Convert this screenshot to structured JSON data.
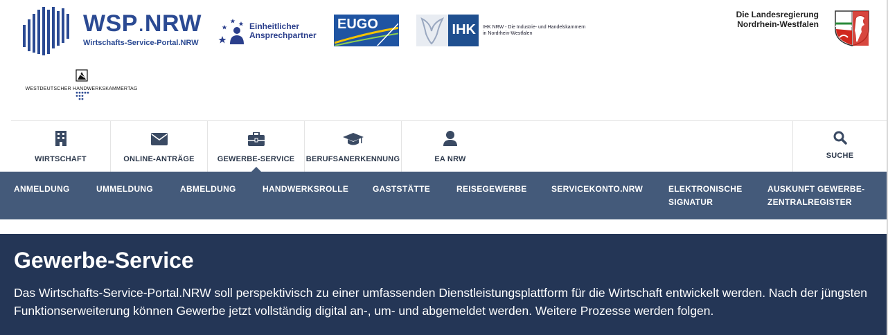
{
  "header": {
    "wsp_title": "WSP",
    "wsp_title_suffix": "NRW",
    "wsp_subtitle": "Wirtschafts-Service-Portal.NRW",
    "eap_line1": "Einheitlicher",
    "eap_line2": "Ansprechpartner",
    "eugo": "EUGO",
    "ihk_word": "IHK",
    "ihk_small_line1": "IHK NRW - Die Industrie- und Handelskammern",
    "ihk_small_line2": "in Nordrhein-Westfalen",
    "landesregierung_line1": "Die Landesregierung",
    "landesregierung_line2": "Nordrhein-Westfalen",
    "hwk_label": "WESTDEUTSCHER HANDWERKSKAMMERTAG"
  },
  "mainnav": {
    "items": [
      {
        "label": "WIRTSCHAFT",
        "icon": "building-icon"
      },
      {
        "label": "ONLINE-ANTRÄGE",
        "icon": "envelope-icon"
      },
      {
        "label": "GEWERBE-SERVICE",
        "icon": "briefcase-icon",
        "active": true
      },
      {
        "label": "BERUFSANERKENNUNG",
        "icon": "graduation-cap-icon"
      },
      {
        "label": "EA NRW",
        "icon": "user-icon"
      }
    ],
    "search_label": "SUCHE"
  },
  "subnav": {
    "items": [
      {
        "line1": "ANMELDUNG",
        "line2": ""
      },
      {
        "line1": "UMMELDUNG",
        "line2": ""
      },
      {
        "line1": "ABMELDUNG",
        "line2": ""
      },
      {
        "line1": "HANDWERKSROLLE",
        "line2": ""
      },
      {
        "line1": "GASTSTÄTTE",
        "line2": ""
      },
      {
        "line1": "REISEGEWERBE",
        "line2": ""
      },
      {
        "line1": "SERVICEKONTO.NRW",
        "line2": ""
      },
      {
        "line1": "ELEKTRONISCHE",
        "line2": "SIGNATUR"
      },
      {
        "line1": "AUSKUNFT GEWERBE-",
        "line2": "ZENTRALREGISTER"
      }
    ]
  },
  "hero": {
    "title": "Gewerbe-Service",
    "text": "Das Wirtschafts-Service-Portal.NRW soll perspektivisch zu einer umfassenden Dienstleistungsplattform für die Wirtschaft entwickelt werden. Nach der jüngsten Funktionserweiterung können Gewerbe jetzt vollständig digital an-, um- und abgemeldet werden. Weitere Prozesse werden folgen."
  },
  "colors": {
    "brand_blue": "#2b4a93",
    "subnav_bg": "#445a7a",
    "hero_bg": "#243656",
    "nav_text": "#2e3a4d"
  }
}
